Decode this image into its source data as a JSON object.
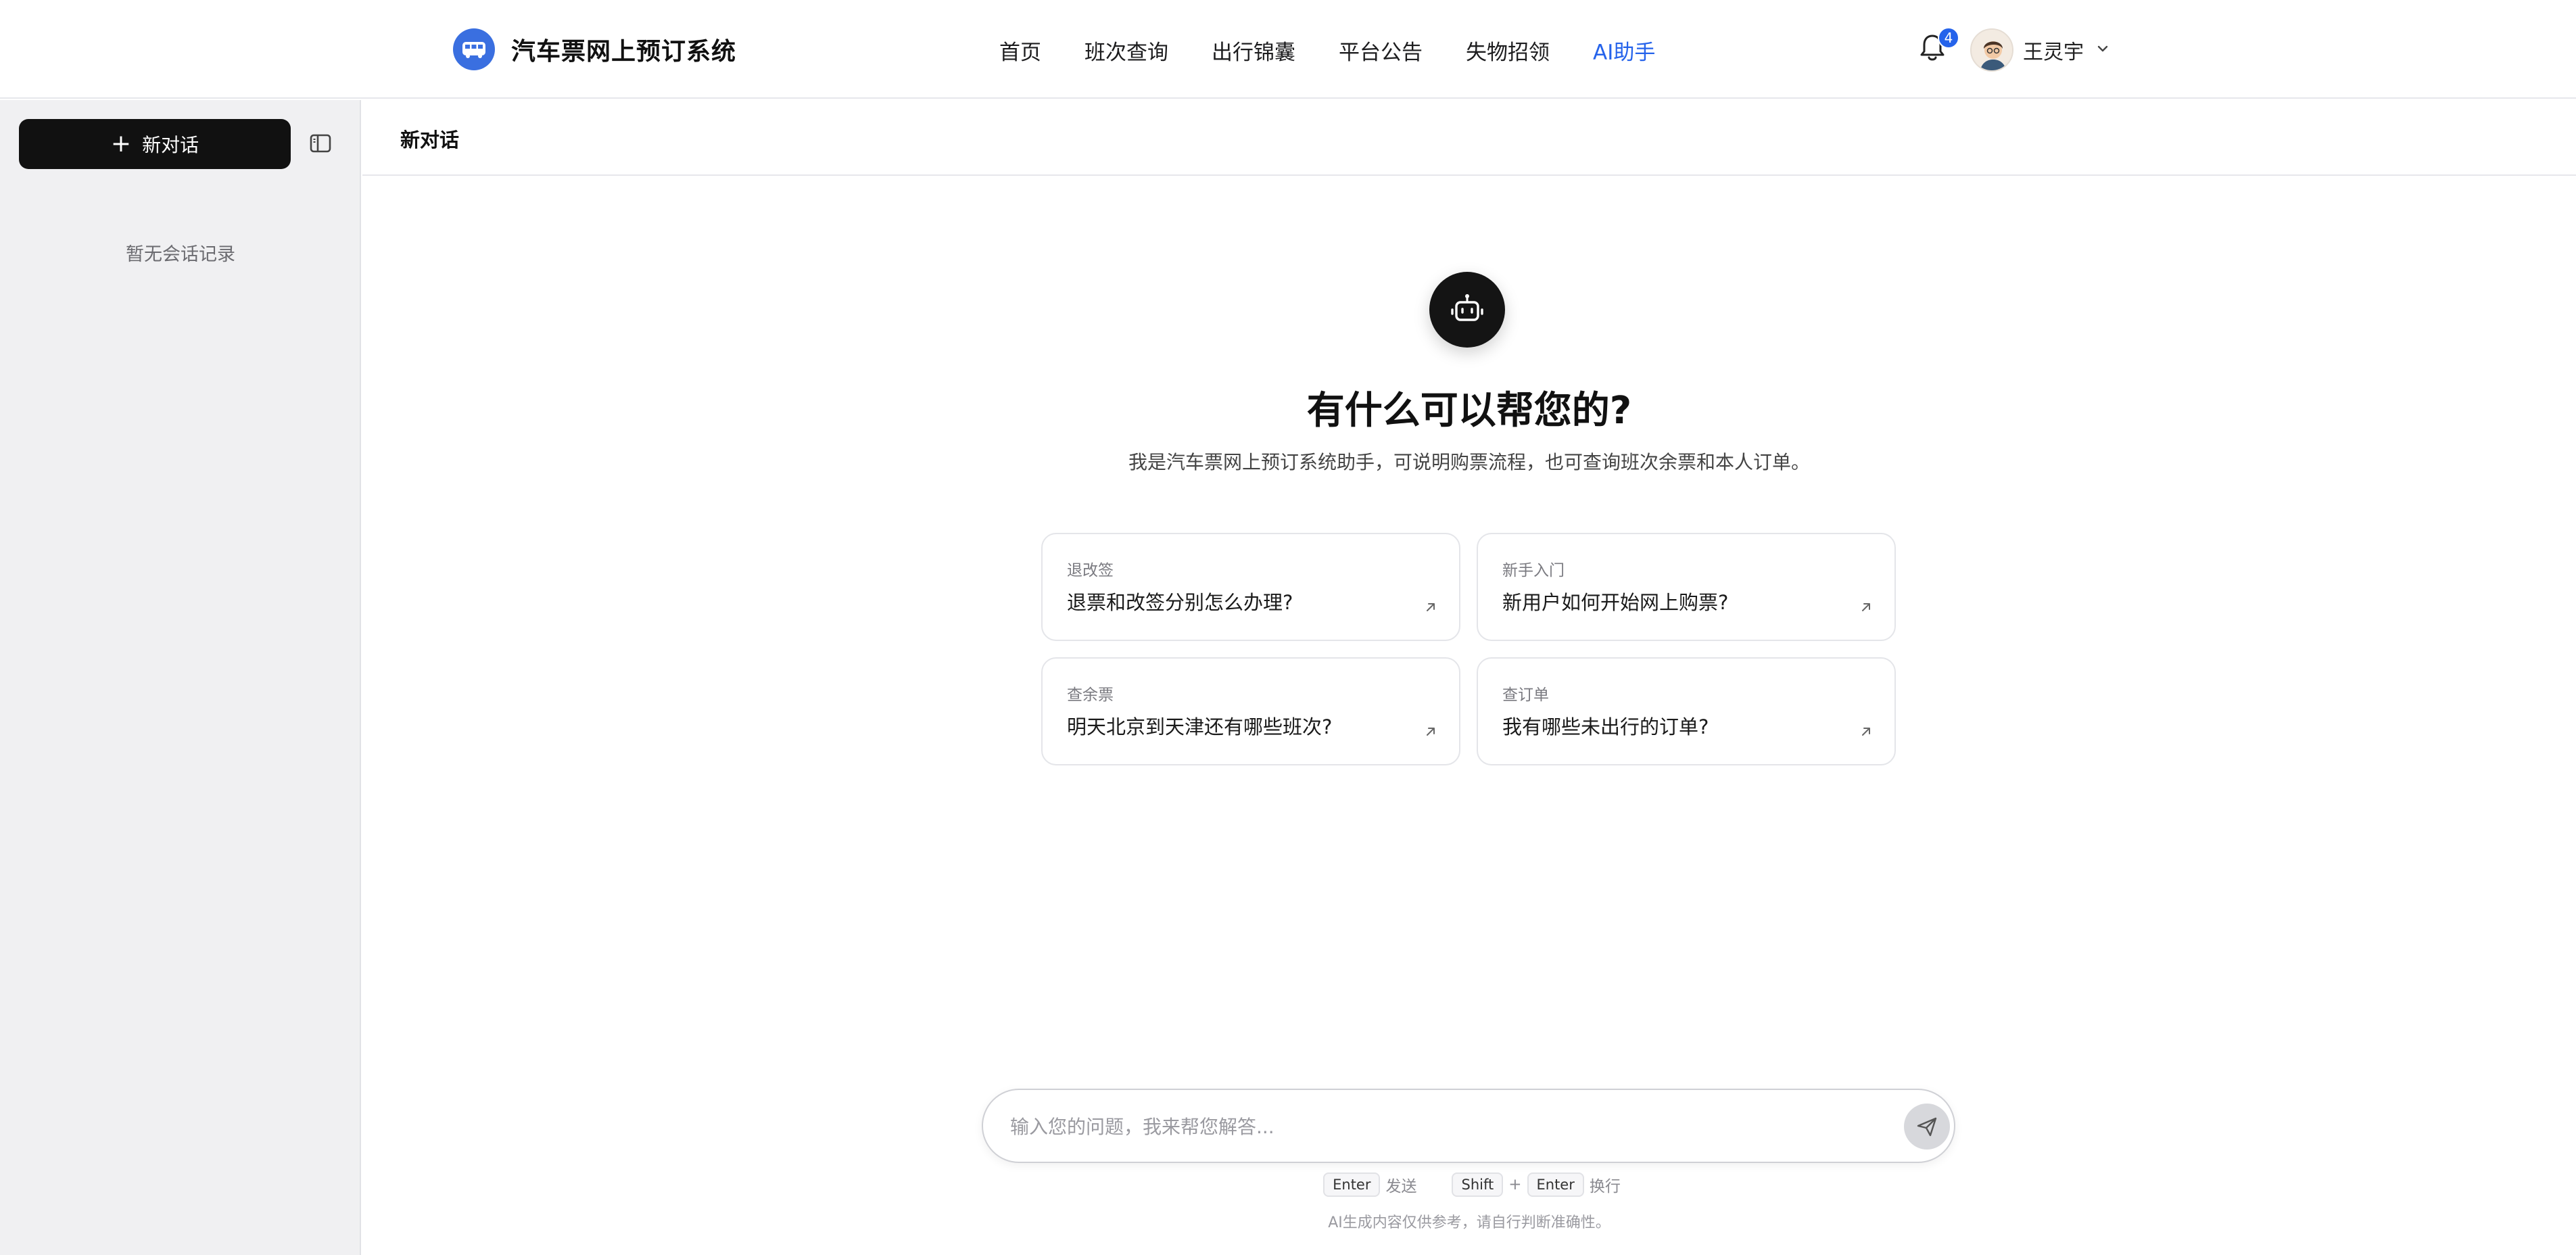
{
  "header": {
    "brand_title": "汽车票网上预订系统",
    "nav": [
      {
        "label": "首页",
        "active": false
      },
      {
        "label": "班次查询",
        "active": false
      },
      {
        "label": "出行锦囊",
        "active": false
      },
      {
        "label": "平台公告",
        "active": false
      },
      {
        "label": "失物招领",
        "active": false
      },
      {
        "label": "AI助手",
        "active": true
      }
    ],
    "notification_count": "4",
    "user_name": "王灵宇"
  },
  "sidebar": {
    "new_chat_label": "新对话",
    "empty_text": "暂无会话记录"
  },
  "main": {
    "conversation_title": "新对话",
    "welcome_title": "有什么可以帮您的?",
    "welcome_subtitle": "我是汽车票网上预订系统助手，可说明购票流程，也可查询班次余票和本人订单。",
    "suggestions": [
      {
        "tag": "退改签",
        "question": "退票和改签分别怎么办理?"
      },
      {
        "tag": "新手入门",
        "question": "新用户如何开始网上购票?"
      },
      {
        "tag": "查余票",
        "question": "明天北京到天津还有哪些班次?"
      },
      {
        "tag": "查订单",
        "question": "我有哪些未出行的订单?"
      }
    ],
    "input_placeholder": "输入您的问题，我来帮您解答...",
    "input_value": "",
    "hints": {
      "enter_key": "Enter",
      "enter_action": "发送",
      "shift_key": "Shift",
      "plus": "+",
      "enter_key_2": "Enter",
      "newline_action": "换行"
    },
    "disclaimer": "AI生成内容仅供参考，请自行判断准确性。"
  },
  "colors": {
    "accent": "#2563eb",
    "brand_logo": "#3a6fe0",
    "primary_button": "#111111",
    "sidebar_bg": "#f0f0f2"
  },
  "icons": {
    "brand": "bus-icon",
    "notifications": "bell-icon",
    "user_menu": "chevron-down-icon",
    "sidebar_toggle": "sidebar-panel-icon",
    "assistant": "robot-icon",
    "suggestion": "arrow-up-right-icon",
    "send": "send-icon"
  }
}
